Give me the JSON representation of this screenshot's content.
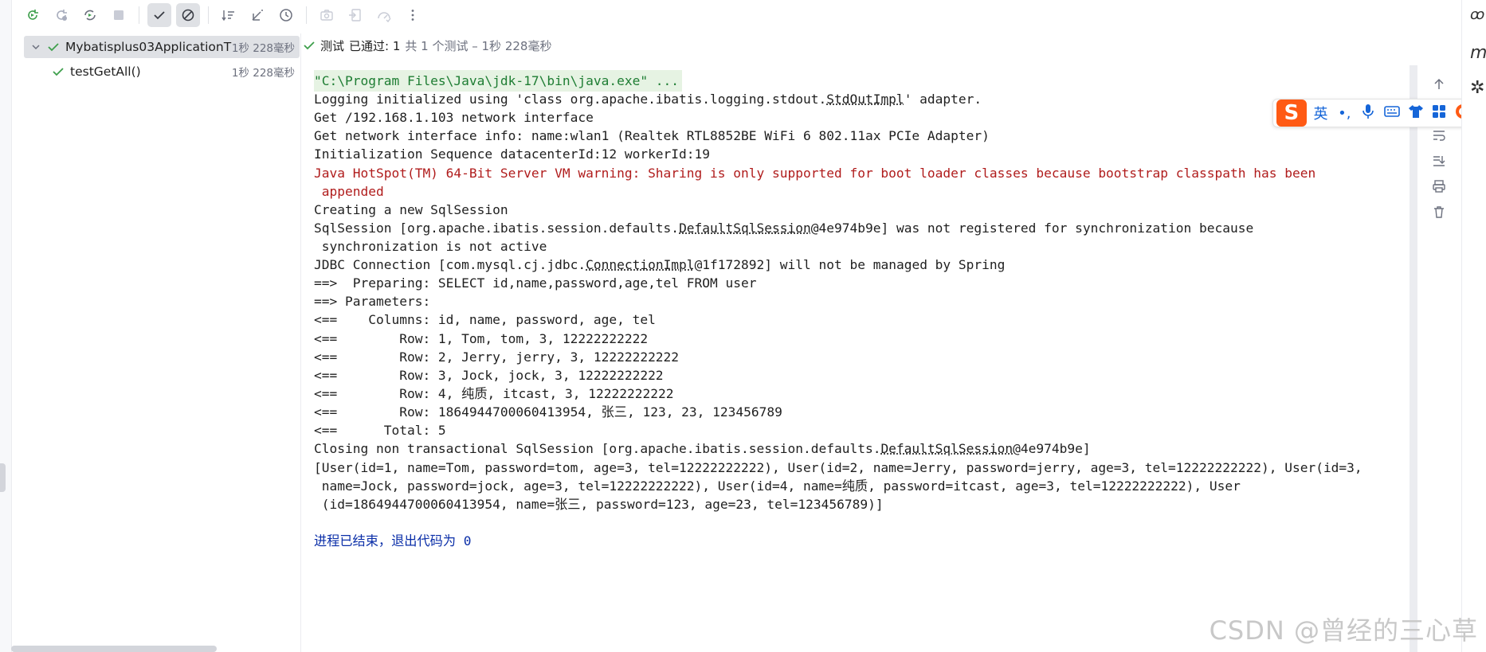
{
  "toolbar": {
    "buttons": [
      {
        "name": "rerun-icon"
      },
      {
        "name": "rerun-failed-icon"
      },
      {
        "name": "toggle-auto-test-icon"
      },
      {
        "name": "stop-icon"
      },
      {
        "name": "show-passed-icon"
      },
      {
        "name": "show-ignored-icon"
      },
      {
        "name": "sort-alpha-icon"
      },
      {
        "name": "sort-duration-icon"
      },
      {
        "name": "test-history-icon"
      },
      {
        "name": "screenshot-icon"
      },
      {
        "name": "import-tests-icon"
      },
      {
        "name": "coverage-icon"
      },
      {
        "name": "more-icon"
      }
    ]
  },
  "tree": {
    "root": {
      "label": "Mybatisplus03ApplicationT",
      "time": "1秒 228毫秒"
    },
    "child": {
      "label": "testGetAll()",
      "time": "1秒 228毫秒"
    }
  },
  "status": {
    "prefix": "测试",
    "passed": "已通过: 1",
    "rest": "共 1 个测试 – 1秒 228毫秒"
  },
  "console": {
    "lines": [
      "\"C:\\Program Files\\Java\\jdk-17\\bin\\java.exe\" ...",
      "Logging initialized using 'class org.apache.ibatis.logging.stdout.StdOutImpl' adapter.",
      "Get /192.168.1.103 network interface",
      "Get network interface info: name:wlan1 (Realtek RTL8852BE WiFi 6 802.11ax PCIe Adapter)",
      "Initialization Sequence datacenterId:12 workerId:19",
      "Java HotSpot(TM) 64-Bit Server VM warning: Sharing is only supported for boot loader classes because bootstrap classpath has been",
      " appended",
      "Creating a new SqlSession",
      "SqlSession [org.apache.ibatis.session.defaults.DefaultSqlSession@4e974b9e] was not registered for synchronization because",
      " synchronization is not active",
      "JDBC Connection [com.mysql.cj.jdbc.ConnectionImpl@1f172892] will not be managed by Spring",
      "==>  Preparing: SELECT id,name,password,age,tel FROM user",
      "==> Parameters: ",
      "<==    Columns: id, name, password, age, tel",
      "<==        Row: 1, Tom, tom, 3, 12222222222",
      "<==        Row: 2, Jerry, jerry, 3, 12222222222",
      "<==        Row: 3, Jock, jock, 3, 12222222222",
      "<==        Row: 4, 纯质, itcast, 3, 12222222222",
      "<==        Row: 1864944700060413954, 张三, 123, 23, 123456789",
      "<==      Total: 5",
      "Closing non transactional SqlSession [org.apache.ibatis.session.defaults.DefaultSqlSession@4e974b9e]",
      "[User(id=1, name=Tom, password=tom, age=3, tel=12222222222), User(id=2, name=Jerry, password=jerry, age=3, tel=12222222222), User(id=3,",
      " name=Jock, password=jock, age=3, tel=12222222222), User(id=4, name=纯质, password=itcast, age=3, tel=12222222222), User",
      " (id=1864944700060413954, name=张三, password=123, age=23, tel=123456789)]",
      "",
      "进程已结束，退出代码为 0"
    ]
  },
  "ime": {
    "logo": "S",
    "items": [
      "英",
      "•,",
      "🎤",
      "⌨",
      "👕",
      "▦",
      "◉"
    ]
  },
  "watermark": "CSDN @曾经的三心草",
  "colors": {
    "pass_green": "#3e9f4c",
    "cmd_bg": "#e6f3e3",
    "error_red": "#b01c1c",
    "exit_blue": "#0a2ea8",
    "ime_orange": "#ff5a14"
  }
}
